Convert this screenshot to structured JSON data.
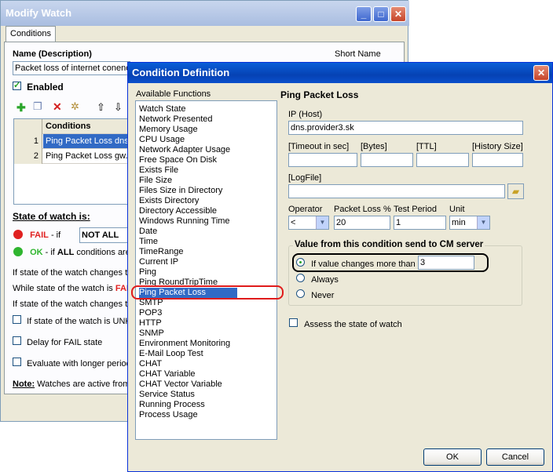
{
  "back_window": {
    "title": "Modify Watch",
    "tab": "Conditions",
    "name_label": "Name (Description)",
    "short_name_label": "Short Name",
    "name_value": "Packet loss of internet conenc",
    "enabled_label": "Enabled",
    "toolbar_icons": [
      "add-icon",
      "copy-icon",
      "delete-icon",
      "settings-icon",
      "move-up-icon",
      "move-down-icon"
    ],
    "grid_header": "Conditions",
    "grid_rows": [
      {
        "num": "1",
        "text": "Ping Packet Loss dns.",
        "selected": true
      },
      {
        "num": "2",
        "text": "Ping Packet Loss gw.p",
        "selected": false
      }
    ],
    "state_label": "State of watch is:",
    "fail_label": "FAIL",
    "fail_if": " - if",
    "fail_select": "NOT ALL",
    "ok_label": "OK",
    "ok_if_pre": " - if ",
    "ok_if_bold": "ALL",
    "ok_if_post": " conditions are",
    "line_changes_1": "If state of the watch changes to",
    "line_while_pre": "While state of the watch is ",
    "line_while_fail": "FAI",
    "line_changes_2": "If state of the watch changes to",
    "chk_unk": "If state of the watch is UNK",
    "chk_delay": "Delay for FAIL state",
    "chk_eval": "Evaluate with longer period",
    "note_bold": "Note:",
    "note_text": " Watches are active from"
  },
  "dialog": {
    "title": "Condition Definition",
    "available_label": "Available Functions",
    "functions": [
      "Watch State",
      "Network Presented",
      "Memory Usage",
      "CPU Usage",
      "Network Adapter Usage",
      "Free Space On Disk",
      "Exists File",
      "File Size",
      "Files Size in Directory",
      "Exists Directory",
      "Directory Accessible",
      "Windows Running Time",
      "Date",
      "Time",
      "TimeRange",
      "Current IP",
      "Ping",
      "Ping RoundTripTime",
      "Ping Packet Loss",
      "SMTP",
      "POP3",
      "HTTP",
      "SNMP",
      "Environment Monitoring",
      "E-Mail Loop Test",
      "CHAT",
      "CHAT Variable",
      "CHAT Vector Variable",
      "Service Status",
      "Running Process",
      "Process Usage"
    ],
    "selected_function": "Ping Packet Loss",
    "section_title": "Ping Packet Loss",
    "ip_label": "IP (Host)",
    "ip_value": "dns.provider3.sk",
    "timeout_label": "[Timeout in sec]",
    "bytes_label": "[Bytes]",
    "ttl_label": "[TTL]",
    "history_label": "[History Size]",
    "logfile_label": "[LogFile]",
    "operator_label": "Operator",
    "operator_value": "<",
    "packetloss_label": "Packet Loss %",
    "packetloss_value": "20",
    "period_label": "Test Period",
    "period_value": "1",
    "unit_label": "Unit",
    "unit_value": "min",
    "group_title": "Value from this condition send to CM server",
    "radio_changes": "If value changes more than",
    "radio_changes_value": "3",
    "radio_always": "Always",
    "radio_never": "Never",
    "assess_label": "Assess the state of watch",
    "ok_button": "OK",
    "cancel_button": "Cancel"
  },
  "colors": {
    "fail": "#e02020",
    "ok": "#2fb52f",
    "selection": "#316ac5",
    "annotation": "#e01b1b"
  }
}
